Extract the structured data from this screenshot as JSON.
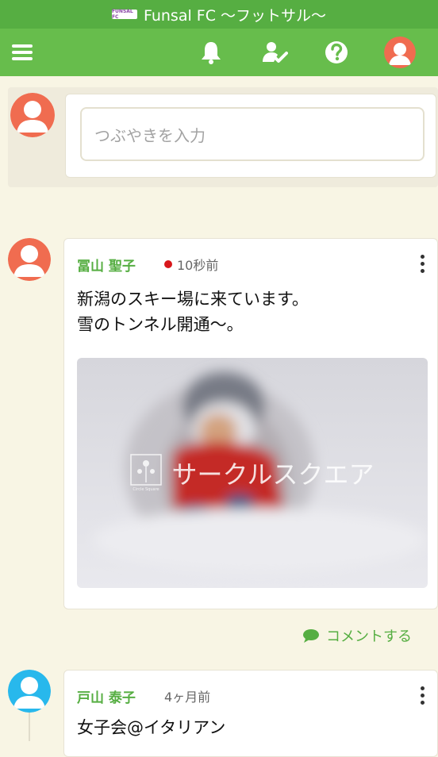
{
  "app": {
    "title": "Funsal FC 〜フットサル〜",
    "logo_text": "FUNSAL FC"
  },
  "nav": {
    "icons": [
      "menu-icon",
      "bell-icon",
      "member-check-icon",
      "help-icon",
      "profile-avatar"
    ]
  },
  "composer": {
    "placeholder": "つぶやきを入力"
  },
  "posts": [
    {
      "author": "冨山 聖子",
      "time": "10秒前",
      "text": "新潟のスキー場に来ています。\n雪のトンネル開通〜。",
      "image_watermark": "サークルスクエア",
      "image_watermark_logo": "Circle Square",
      "comment_label": "コメントする"
    },
    {
      "author": "戸山 泰子",
      "time": "4ヶ月前",
      "text": "女子会@イタリアン"
    }
  ],
  "colors": {
    "brand_green": "#67bd4c",
    "title_green": "#56ae42",
    "background": "#f8f5e4",
    "avatar_orange": "#f06c50",
    "avatar_blue": "#28b8ec",
    "new_dot": "#d8171b"
  }
}
